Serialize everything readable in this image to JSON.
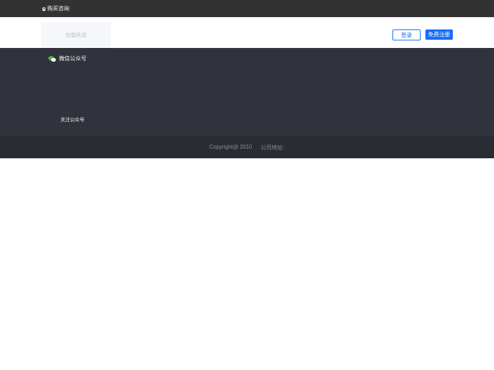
{
  "topbar": {
    "contact_icon": "phone-icon",
    "contact_label": "购买咨询"
  },
  "header": {
    "logo_placeholder": "加载失败",
    "login_label": "登录",
    "register_label": "免费注册"
  },
  "footer": {
    "wechat_icon": "wechat-icon",
    "wechat_title": "微信公众号",
    "follow_label": "关注公众号",
    "copyright": "Copyright@ 2010",
    "address_label": "公司地址:"
  },
  "colors": {
    "accent": "#1a6df5",
    "topbar_bg": "#323232",
    "footer_bg": "#30333b",
    "footer_bottom_bg": "#2a2c33",
    "wechat_green": "#4cbf4c"
  }
}
